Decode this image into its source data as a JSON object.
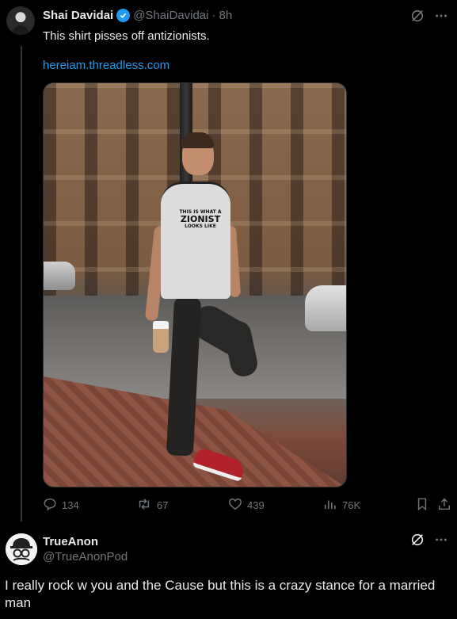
{
  "tweet": {
    "author_name": "Shai Davidai",
    "author_handle": "@ShaiDavidai",
    "separator": "·",
    "time": "8h",
    "text": "This shirt pisses off antizionists.",
    "link": "hereiam.threadless.com",
    "photo": {
      "shirt_line1": "THIS IS WHAT A",
      "shirt_line2": "ZIONIST",
      "shirt_line3": "LOOKS LIKE"
    },
    "stats": {
      "replies": "134",
      "reposts": "67",
      "likes": "439",
      "views": "76K"
    }
  },
  "reply": {
    "author_name": "TrueAnon",
    "author_handle": "@TrueAnonPod",
    "text": "I really rock w you and the Cause but this is a crazy stance for a married man"
  },
  "colors": {
    "background": "#000000",
    "text": "#e7e9ea",
    "muted": "#71767b",
    "link": "#1d9bf0",
    "verified": "#1d9bf0"
  },
  "icons": [
    "verified-badge-icon",
    "grok-icon",
    "more-icon",
    "reply-icon",
    "repost-icon",
    "like-icon",
    "views-icon",
    "bookmark-icon",
    "share-icon"
  ]
}
